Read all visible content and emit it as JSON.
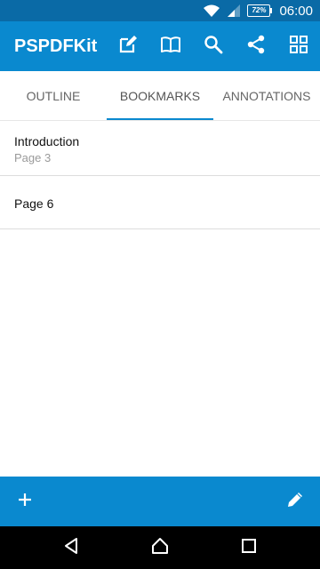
{
  "status_bar": {
    "battery_percent": "72%",
    "time": "06:00",
    "icons": [
      "wifi-icon",
      "signal-icon",
      "battery-icon"
    ]
  },
  "toolbar": {
    "title": "PSPDFKit",
    "actions": [
      "annotate-icon",
      "book-icon",
      "search-icon",
      "share-icon",
      "grid-icon"
    ],
    "color": "#0a89cf"
  },
  "tabs": [
    {
      "label": "OUTLINE",
      "active": false
    },
    {
      "label": "BOOKMARKS",
      "active": true
    },
    {
      "label": "ANNOTATIONS",
      "active": false
    }
  ],
  "bookmarks": [
    {
      "title": "Introduction",
      "page": "Page 3"
    },
    {
      "title": "Page 6",
      "page": ""
    }
  ],
  "bottom_bar": {
    "actions": [
      "add-icon",
      "edit-pencil-icon"
    ]
  },
  "nav_bar": {
    "buttons": [
      "back-icon",
      "home-icon",
      "recents-icon"
    ]
  },
  "colors": {
    "status_bar": "#0a6aa6",
    "accent": "#0a89cf"
  }
}
